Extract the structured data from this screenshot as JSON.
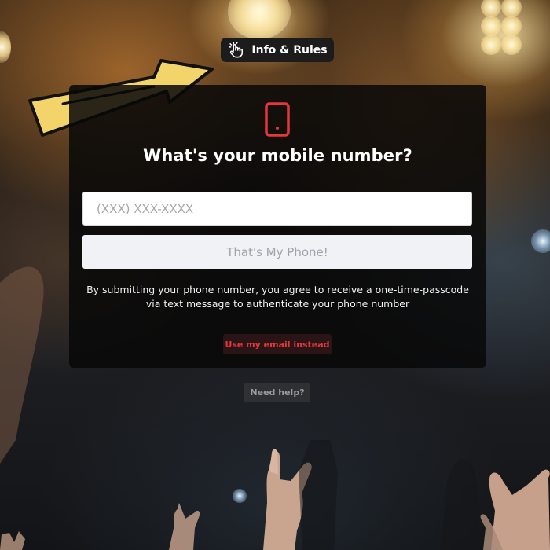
{
  "header": {
    "info_button_label": "Info & Rules",
    "info_icon": "hand-pointer-icon"
  },
  "card": {
    "icon": "mobile-phone-icon",
    "title": "What's your mobile number?",
    "phone_input": {
      "value": "",
      "placeholder": "(XXX) XXX-XXXX"
    },
    "submit_label": "That's My Phone!",
    "disclaimer": "By submitting your phone number, you agree to receive a one-time-passcode via text message to authenticate your phone number",
    "email_link_label": "Use my email instead"
  },
  "footer": {
    "help_label": "Need help?"
  },
  "colors": {
    "accent": "#e5363c",
    "arrow_fill": "#f3d46a",
    "card_bg": "#080808",
    "button_disabled_bg": "#f1f2f5",
    "button_disabled_text": "#a0a3ab"
  }
}
